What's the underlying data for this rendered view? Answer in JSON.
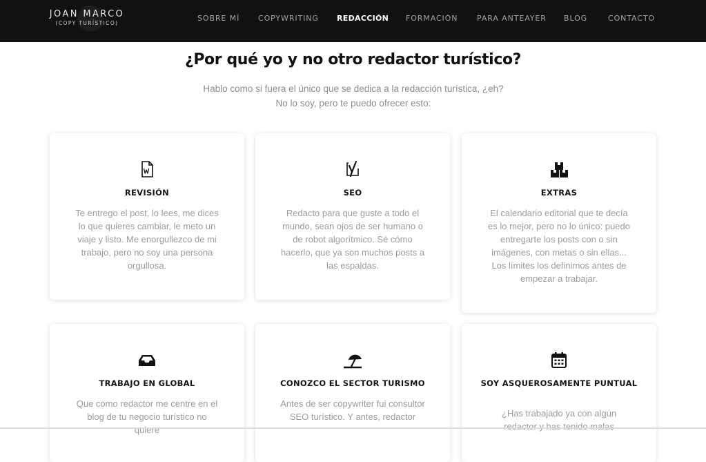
{
  "header": {
    "logo_name": "JOAN MARCO",
    "logo_sub": "(COPY TURÍSTICO)",
    "nav": [
      {
        "label": "SOBRE MÍ",
        "active": false
      },
      {
        "label": "COPYWRITING",
        "active": false
      },
      {
        "label": "REDACCIÓN",
        "active": true
      },
      {
        "label": "FORMACIÓN",
        "active": false
      },
      {
        "label": "PARA ANTEAYER",
        "active": false
      },
      {
        "label": "BLOG",
        "active": false
      },
      {
        "label": "CONTACTO",
        "active": false
      }
    ]
  },
  "section": {
    "heading": "¿Por qué yo y no otro redactor turístico?",
    "intro_line1": "Hablo como si fuera el único que se dedica a la redacción turística, ¿eh?",
    "intro_line2": "No lo soy, pero te puedo ofrecer esto:"
  },
  "cards": [
    {
      "icon": "word-document-icon",
      "title": "REVISIÓN",
      "text": "Te entrego el post, lo lees, me dices lo que quieres cambiar, le meto un viaje y listo.  Me enorgullezco de mi trabajo, pero no soy una persona orgullosa."
    },
    {
      "icon": "yoast-seo-icon",
      "title": "SEO",
      "text": "Redacto para que guste a todo el mundo, sean ojos de ser humano o de robot algorítmico. Sé cómo hacerlo, que ya son muchos posts a las espaldas."
    },
    {
      "icon": "boxes-icon",
      "title": "EXTRAS",
      "text": "El calendario editorial que te decía es lo mejor, pero no lo único: puedo entregarte los posts con o sin imágenes, con metas o sin ellas... Los límites los definimos antes de empezar a trabajar."
    },
    {
      "icon": "inbox-tray-icon",
      "title": "TRABAJO EN GLOBAL",
      "text": "Que como redactor me centre en el blog de tu negocio turístico no quiere"
    },
    {
      "icon": "beach-umbrella-icon",
      "title": "CONOZCO EL SECTOR TURISMO",
      "text": "Antes de ser copywriter fui consultor SEO turístico. Y antes, redactor"
    },
    {
      "icon": "calendar-icon",
      "title": "SOY ASQUEROSAMENTE PUNTUAL",
      "text": "¿Has trabajado ya con algún redactor y has tenido malas"
    }
  ],
  "colors": {
    "topbar": "#111111",
    "nav_text": "#a3a3a3",
    "nav_active": "#ffffff",
    "heading": "#111111",
    "body_text": "#9b9b9b"
  }
}
